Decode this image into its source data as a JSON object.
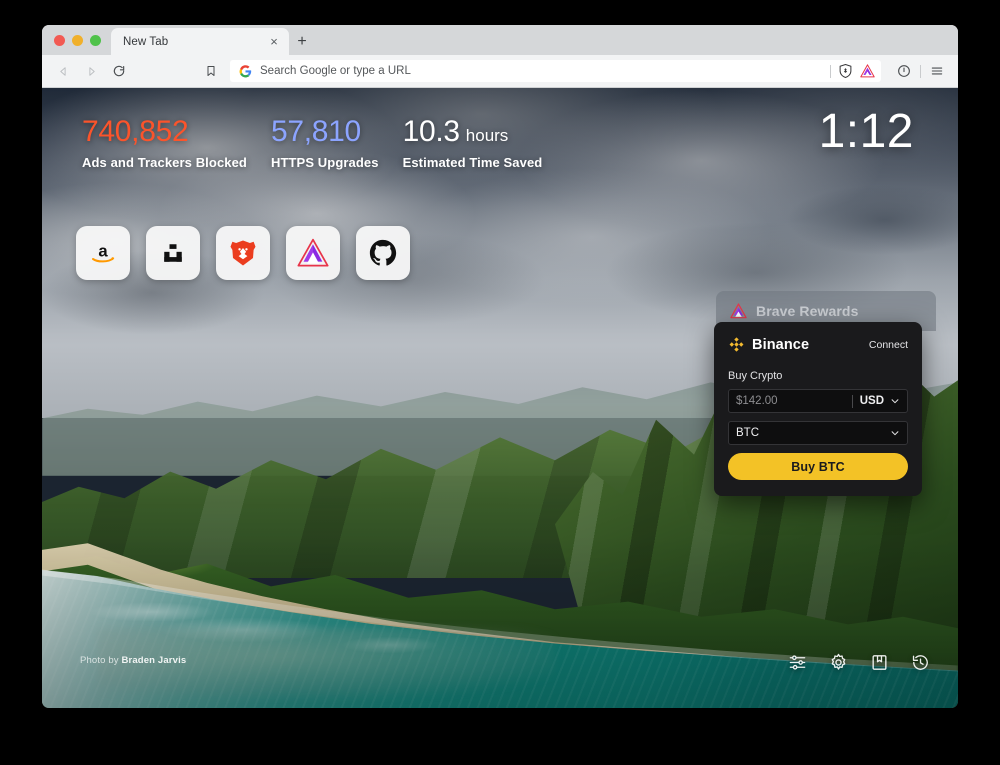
{
  "window": {
    "traffic_lights": [
      "close",
      "minimize",
      "zoom"
    ]
  },
  "tabstrip": {
    "tab_title": "New Tab",
    "close_glyph": "×",
    "new_tab_glyph": "+"
  },
  "toolbar": {
    "back": "back-arrow",
    "forward": "forward-arrow",
    "reload": "reload",
    "bookmark": "bookmark",
    "omnibox": {
      "placeholder": "Search Google or type a URL",
      "search_engine_icon": "google-g-icon",
      "shields_icon": "brave-shields-icon",
      "rewards_icon": "brave-rewards-triangle-icon"
    },
    "info_icon": "info-circle-icon",
    "menu_icon": "hamburger-menu-icon"
  },
  "newtab": {
    "clock": "1:12",
    "stats": [
      {
        "value": "740,852",
        "unit": "",
        "label": "Ads and Trackers Blocked",
        "color": "#fb542b"
      },
      {
        "value": "57,810",
        "unit": "",
        "label": "HTTPS Upgrades",
        "color": "#8ca4ff"
      },
      {
        "value": "10.3",
        "unit": "hours",
        "label": "Estimated Time Saved",
        "color": "#ffffff"
      }
    ],
    "tiles": [
      {
        "name": "amazon",
        "icon": "amazon-icon"
      },
      {
        "name": "uphold",
        "icon": "uphold-icon"
      },
      {
        "name": "brave",
        "icon": "brave-lion-icon"
      },
      {
        "name": "bat",
        "icon": "bat-triangle-icon"
      },
      {
        "name": "github",
        "icon": "github-icon"
      }
    ],
    "photo_credit_prefix": "Photo by ",
    "photo_credit_author": "Braden Jarvis",
    "actions": [
      {
        "name": "customize",
        "icon": "sliders-icon"
      },
      {
        "name": "settings",
        "icon": "gear-icon"
      },
      {
        "name": "bookmarks",
        "icon": "bookmarks-book-icon"
      },
      {
        "name": "history",
        "icon": "history-clock-icon"
      }
    ]
  },
  "rewards_widget": {
    "tab_label": "Brave Rewards",
    "tab_icon": "bat-triangle-icon",
    "binance": {
      "brand_icon": "binance-diamond-icon",
      "brand_name": "Binance",
      "connect_label": "Connect",
      "section_label": "Buy Crypto",
      "amount_value": "$142.00",
      "currency_value": "USD",
      "asset_value": "BTC",
      "buy_button_label": "Buy BTC",
      "accent_color": "#f3c226"
    }
  }
}
